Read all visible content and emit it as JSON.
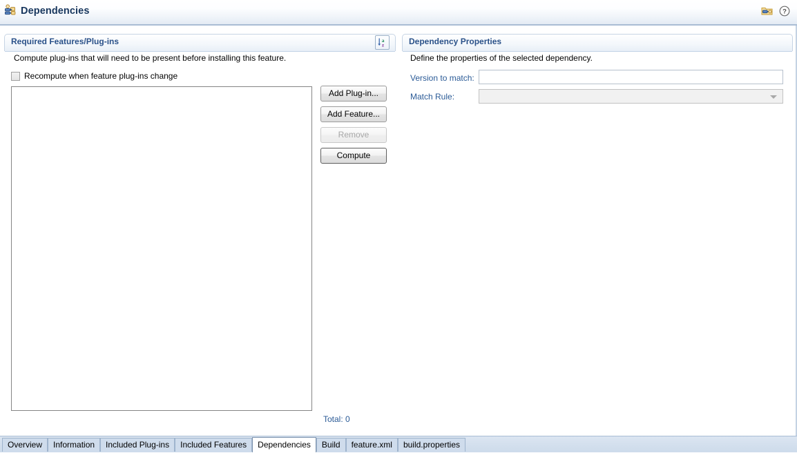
{
  "header": {
    "title": "Dependencies",
    "title_icon": "dependencies-plug-icon",
    "icons": [
      {
        "name": "plug-folder-icon"
      },
      {
        "name": "help-question-icon"
      }
    ]
  },
  "left_section": {
    "title": "Required Features/Plug-ins",
    "description": "Compute plug-ins that will need to be present before installing this feature.",
    "sort_button_icon": "sort-az-icon",
    "checkbox": {
      "label": "Recompute when feature plug-ins change",
      "checked": false
    },
    "list": {
      "items": [],
      "total_label": "Total: 0"
    },
    "buttons": [
      {
        "label": "Add Plug-in...",
        "enabled": true,
        "default": false
      },
      {
        "label": "Add Feature...",
        "enabled": true,
        "default": false
      },
      {
        "label": "Remove",
        "enabled": false,
        "default": false
      },
      {
        "label": "Compute",
        "enabled": true,
        "default": true
      }
    ]
  },
  "right_section": {
    "title": "Dependency Properties",
    "description": "Define the properties of the selected dependency.",
    "fields": {
      "version_label": "Version to match:",
      "version_value": "",
      "version_placeholder": "",
      "match_rule_label": "Match Rule:",
      "match_rule_value": ""
    }
  },
  "tabs": [
    {
      "label": "Overview",
      "selected": false
    },
    {
      "label": "Information",
      "selected": false
    },
    {
      "label": "Included Plug-ins",
      "selected": false
    },
    {
      "label": "Included Features",
      "selected": false
    },
    {
      "label": "Dependencies",
      "selected": true
    },
    {
      "label": "Build",
      "selected": false
    },
    {
      "label": "feature.xml",
      "selected": false
    },
    {
      "label": "build.properties",
      "selected": false
    }
  ],
  "colors": {
    "header_title": "#17365d",
    "section_title": "#2a5189",
    "field_label": "#2a5a96",
    "total_label": "#2a5a96",
    "tab_bar": "#cddbeb"
  }
}
